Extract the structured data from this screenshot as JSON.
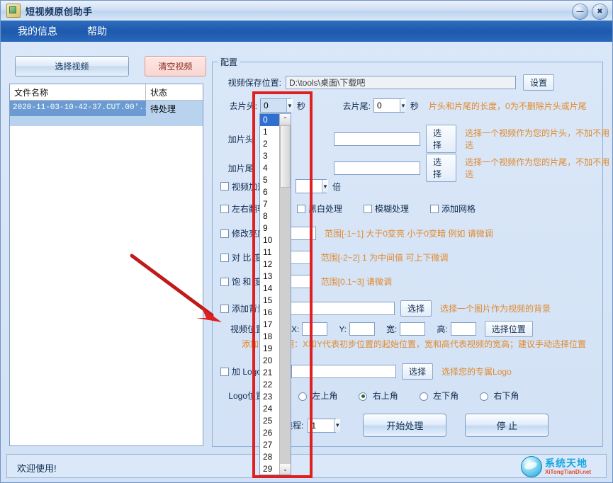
{
  "window": {
    "title": "短视频原创助手",
    "icon": "app-icon",
    "minimize_label": "—",
    "close_label": "✖"
  },
  "menu": {
    "items": [
      {
        "label": "我的信息"
      },
      {
        "label": "帮助"
      }
    ]
  },
  "left_panel": {
    "select_video_button": "选择视频",
    "clear_video_button": "清空视频",
    "columns": [
      "文件名称",
      "状态"
    ],
    "rows": [
      {
        "name": "2020-11-03-10-42-37.CUT.00'...",
        "status": "待处理"
      }
    ]
  },
  "config": {
    "group_title": "配置",
    "save_path": {
      "label": "视频保存位置:",
      "value": "D:\\tools\\桌面\\下载吧",
      "button": "设置"
    },
    "trim_head": {
      "label": "去片头:",
      "value": "0",
      "unit": "秒"
    },
    "trim_tail": {
      "label": "去片尾:",
      "value": "0",
      "unit": "秒",
      "hint": "片头和片尾的长度，0为不删除片头或片尾"
    },
    "add_head": {
      "label": "加片头:",
      "value": "",
      "button": "选择",
      "hint": "选择一个视频作为您的片头，不加不用选"
    },
    "add_tail": {
      "label": "加片尾:",
      "value": "",
      "button": "选择",
      "hint": "选择一个视频作为您的片尾，不加不用选"
    },
    "speed": {
      "label": "视频加速",
      "checked": false,
      "value": "",
      "unit": "倍"
    },
    "flip": {
      "label": "左右翻转",
      "checked": false
    },
    "grayscale": {
      "label": "黑白处理",
      "checked": false
    },
    "blur": {
      "label": "模糊处理",
      "checked": false
    },
    "grid": {
      "label": "添加网格",
      "checked": false
    },
    "brightness": {
      "label": "修改亮度",
      "checked": false,
      "value": "",
      "hint": "范围[-1~1]  大于0变亮 小于0变暗 例如 请微调"
    },
    "contrast": {
      "label": "对 比 度",
      "checked": false,
      "value": "",
      "hint": "范围[-2~2] 1 为中间值 可上下微调"
    },
    "saturation": {
      "label": "饱 和 度",
      "checked": false,
      "value": "",
      "hint": "范围[0.1~3]  请微调"
    },
    "background": {
      "label": "添加背景",
      "checked": false,
      "value": "",
      "button": "选择",
      "hint": "选择一个图片作为视频的背景"
    },
    "video_position": {
      "label": "视频位置",
      "x_label": "X:",
      "x_value": "",
      "y_label": "Y:",
      "y_value": "",
      "w_label": "宽:",
      "w_value": "",
      "h_label": "高:",
      "h_value": "",
      "button": "选择位置",
      "note_prefix": "添加",
      "note": "明：X和Y代表初步位置的起始位置，宽和高代表视频的宽高；建议手动选择位置"
    },
    "logo": {
      "label": "加 Logo",
      "checked": false,
      "value": "",
      "button": "选择",
      "hint": "选择您的专属Logo"
    },
    "logo_position": {
      "label": "Logo位置",
      "options": [
        {
          "label": "左上角",
          "selected": false
        },
        {
          "label": "右上角",
          "selected": true
        },
        {
          "label": "左下角",
          "selected": false
        },
        {
          "label": "右下角",
          "selected": false
        }
      ]
    },
    "threads": {
      "label": "线程:",
      "value": "1"
    },
    "start_button": "开始处理",
    "stop_button": "停  止"
  },
  "dropdown": {
    "open": true,
    "selected": "0",
    "options": [
      "0",
      "1",
      "2",
      "3",
      "4",
      "5",
      "6",
      "7",
      "8",
      "9",
      "10",
      "11",
      "12",
      "13",
      "14",
      "15",
      "16",
      "17",
      "18",
      "19",
      "20",
      "21",
      "22",
      "23",
      "24",
      "25",
      "26",
      "27",
      "28",
      "29"
    ],
    "scroll_up": "⌃",
    "scroll_down": "⌄"
  },
  "annotation": {
    "highlight_color": "#e02020",
    "arrow_color": "#c01a1a"
  },
  "status": {
    "text": "欢迎使用!"
  },
  "watermark": {
    "cn": "系统天地",
    "en": "XiTongTianDi.net"
  }
}
